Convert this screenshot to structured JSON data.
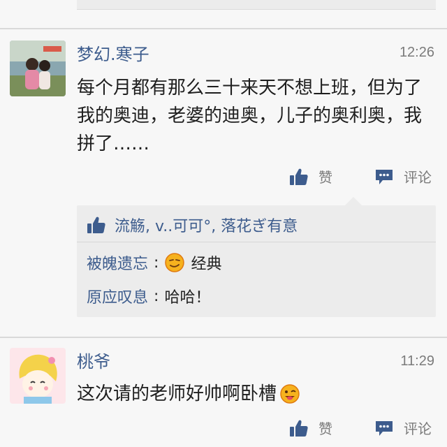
{
  "colors": {
    "link_blue": "#3d5c8d",
    "meta_gray": "#7b7b7b",
    "panel_gray": "#ececec",
    "emoji_yellow": "#f6b21e"
  },
  "posts": [
    {
      "username": "梦幻.寒子",
      "time": "12:26",
      "content": "每个月都有那么三十来天不想上班，但为了我的奥迪，老婆的迪奥，儿子的奥利奥，我拼了……",
      "like_label": "赞",
      "comment_label": "评论",
      "likes": {
        "icon": "thumbs-up-icon",
        "names": "流觞, v..可可°, 落花ぎ有意"
      },
      "comments": [
        {
          "user": "被魄遗忘",
          "sep": ":",
          "emoji": "smirk-emoji-icon",
          "text": "经典"
        },
        {
          "user": "原应叹息",
          "sep": ":",
          "text": "哈哈！"
        }
      ]
    },
    {
      "username": "桃爷",
      "time": "11:29",
      "content": "这次请的老师好帅啊卧槽",
      "emoji": "wink-tongue-emoji-icon",
      "like_label": "赞",
      "comment_label": "评论"
    }
  ]
}
